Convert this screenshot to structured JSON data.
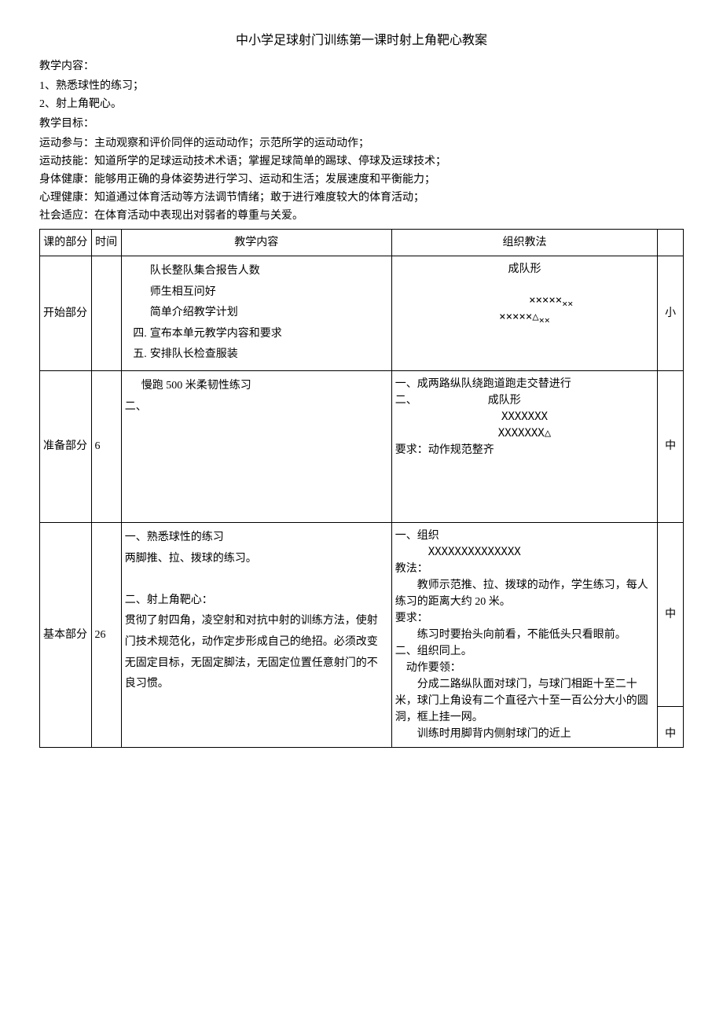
{
  "title": "中小学足球射门训练第一课时射上角靶心教案",
  "headings": {
    "content": "教学内容：",
    "goal": "教学目标："
  },
  "contentItems": {
    "c1": "1、熟悉球性的练习；",
    "c2": "2、射上角靶心。"
  },
  "goals": {
    "g1": "运动参与：主动观察和评价同伴的运动动作；示范所学的运动动作；",
    "g2": "运动技能：知道所学的足球运动技术术语；掌握足球简单的踢球、停球及运球技术；",
    "g3": "身体健康：能够用正确的身体姿势进行学习、运动和生活；发展速度和平衡能力；",
    "g4": "心理健康：知道通过体育活动等方法调节情绪；敢于进行难度较大的体育活动；",
    "g5": "社会适应：在体育活动中表现出对弱者的尊重与关爱。"
  },
  "tableHeaders": {
    "part": "课的部分",
    "time": "时间",
    "content": "教学内容",
    "method": "组织教法",
    "intensity": ""
  },
  "rows": {
    "start": {
      "part": "开始部分",
      "time": "",
      "num4": "四.",
      "num5": "五.",
      "c1": "队长整队集合报告人数",
      "c2": "师生相互问好",
      "c3": "简单介绍教学计划",
      "c4": "宣布本单元教学内容和要求",
      "c5": "安排队长检查服装",
      "m_title": "成队形",
      "m_line1": "×××××",
      "m_line1b": "××",
      "m_line2": "×××××△",
      "m_line2b": "××",
      "intensity": "小"
    },
    "prep": {
      "part": "准备部分",
      "time": "6",
      "num2": "二、",
      "c1": "慢跑 500 米柔韧性练习",
      "m1": "一、成两路纵队绕跑道跑走交替进行",
      "m2a": "二、",
      "m2b": "成队形",
      "m3": "XXXXXXX",
      "m4": "XXXXXXX△",
      "m5": "要求：动作规范整齐",
      "intensity": "中"
    },
    "basic": {
      "part": "基本部分",
      "time": "26",
      "c1": "一、熟悉球性的练习",
      "c2": "两脚推、拉、拨球的练习。",
      "c3": "二、射上角靶心：",
      "c4": "贯彻了射四角，凌空射和对抗中射的训练方法，使射门技术规范化，动作定步形成自己的绝招。必须改变无固定目标，无固定脚法，无固定位置任意射门的不良习惯。",
      "m1": "一、组织",
      "m2": "XXXXXXXXXXXXXX",
      "m3": "教法：",
      "m4": "教师示范推、拉、拨球的动作，学生练习，每人练习的距离大约 20 米。",
      "m5": "要求：",
      "m6": "练习时要抬头向前看，不能低头只看眼前。",
      "m7": "二、组织同上。",
      "m8": "动作要领：",
      "m9": "分成二路纵队面对球门，与球门相距十至二十米，球门上角设有二个直径六十至一百公分大小的圆洞，框上挂一网。",
      "m10": "训练时用脚背内侧射球门的近上",
      "intensity": "中",
      "intensity2": "中"
    }
  }
}
